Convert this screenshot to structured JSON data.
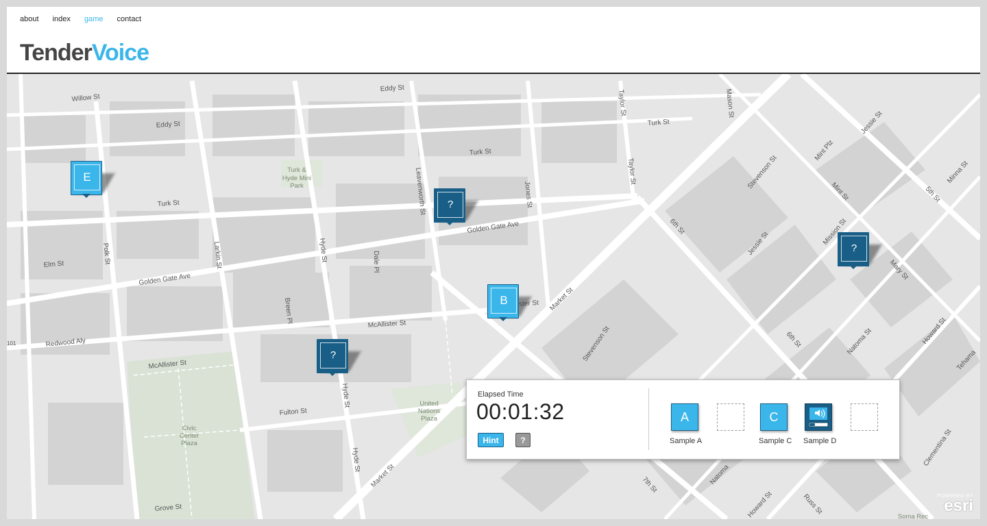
{
  "nav": {
    "items": [
      {
        "label": "about",
        "active": false
      },
      {
        "label": "index",
        "active": false
      },
      {
        "label": "game",
        "active": true
      },
      {
        "label": "contact",
        "active": false
      }
    ]
  },
  "logo": {
    "part1": "Tender",
    "part2": "Voice"
  },
  "map": {
    "street_labels": [
      "Willow St",
      "Eddy St",
      "Eddy St",
      "Turk St",
      "Turk St",
      "Turk St",
      "Taylor St",
      "Taylor St",
      "Mason St",
      "Golden Gate Ave",
      "Golden Gate Ave",
      "Elm St",
      "Redwood Aly",
      "McAllister St",
      "McAllister St",
      "Polk St",
      "Larkin St",
      "Hyde St",
      "Hyde St",
      "Hyde St",
      "Dale Pl",
      "Leavenworth St",
      "Jones St",
      "Breen Pl",
      "Market St",
      "Market St",
      "Stevenson St",
      "Stevenson St",
      "6th St",
      "6th St",
      "7th St",
      "Jessie St",
      "Jessie St",
      "Mint Plz",
      "Mint St",
      "Mission St",
      "Mary St",
      "Natoma St",
      "Natoma",
      "Howard St",
      "Howard St",
      "Russ St",
      "5th St",
      "Minna St",
      "Tehama",
      "Clementina St",
      "Fulton St",
      "Grove St",
      "ister St"
    ],
    "place_labels": [
      "Turk &",
      "Hyde Mini",
      "Park",
      "Civic",
      "Center",
      "Plaza",
      "United",
      "Nations",
      "Plaza",
      "Soma Rec"
    ],
    "edge_label": "101"
  },
  "markers": [
    {
      "label": "E",
      "style": "light"
    },
    {
      "label": "?",
      "style": "dark"
    },
    {
      "label": "B",
      "style": "light"
    },
    {
      "label": "?",
      "style": "dark"
    },
    {
      "label": "?",
      "style": "dark"
    }
  ],
  "panel": {
    "elapsed_label": "Elapsed Time",
    "elapsed_time": "00:01:32",
    "hint_label": "Hint",
    "help_label": "?",
    "slots": [
      {
        "letter": "A",
        "label": "Sample A",
        "state": "filled"
      },
      {
        "letter": "",
        "label": "",
        "state": "empty"
      },
      {
        "letter": "C",
        "label": "Sample C",
        "state": "filled"
      },
      {
        "letter": "",
        "label": "Sample D",
        "state": "playing",
        "icon": "speaker-icon",
        "progress": 0.3
      },
      {
        "letter": "",
        "label": "",
        "state": "empty"
      }
    ]
  },
  "attribution": {
    "small": "POWERED BY",
    "big": "esri"
  },
  "colors": {
    "accent": "#3bb6ea",
    "marker_dark": "#185e87",
    "map_bg": "#e8e8e8",
    "road": "#ffffff",
    "park": "#d9e2d5"
  }
}
